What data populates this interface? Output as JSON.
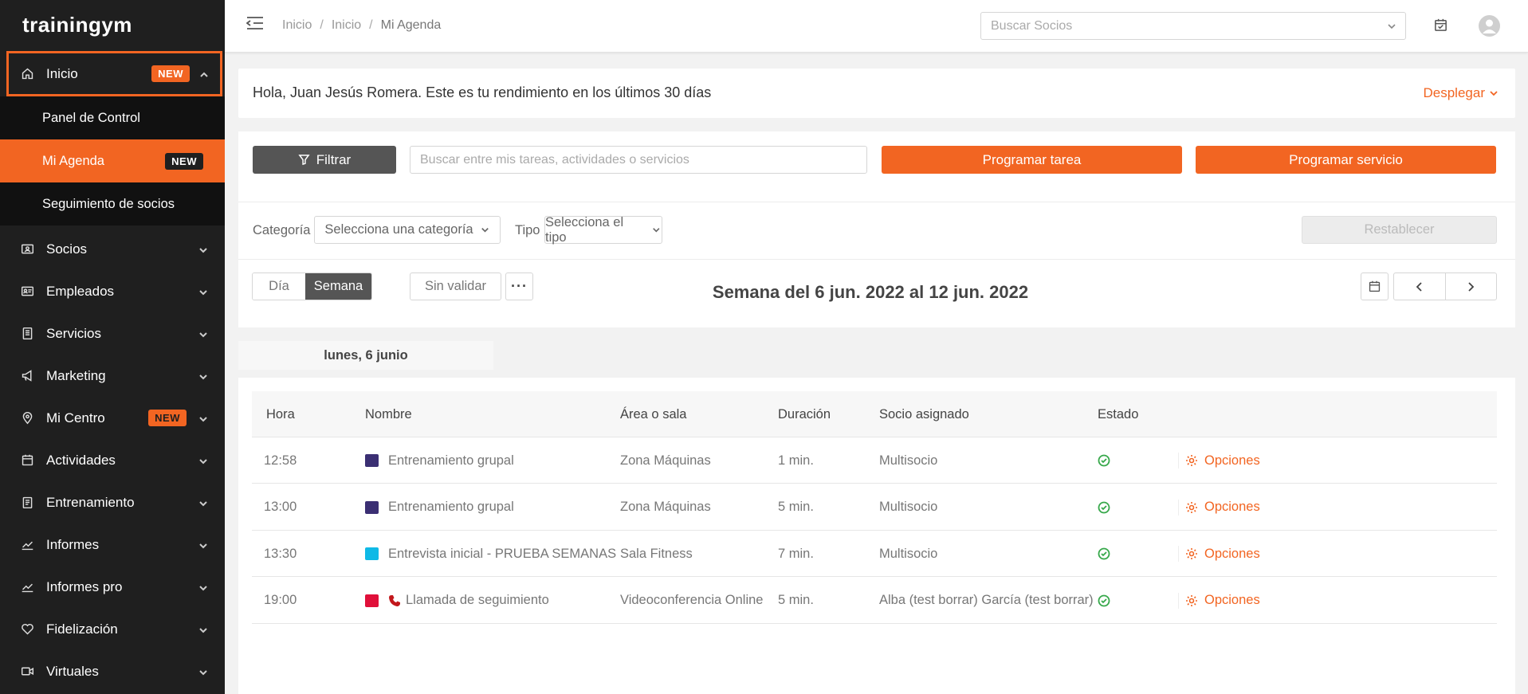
{
  "brand": {
    "logo_text": "trainingym",
    "accent": "#f26522",
    "sidebar_bg": "#1f1f1f"
  },
  "sidebar": {
    "home": {
      "label": "Inicio",
      "badge": "NEW",
      "icon": "home-icon"
    },
    "submenu": [
      {
        "label": "Panel de Control",
        "badge": ""
      },
      {
        "label": "Mi Agenda",
        "badge": "NEW"
      },
      {
        "label": "Seguimiento de socios",
        "badge": ""
      }
    ],
    "items": [
      {
        "label": "Socios",
        "icon": "id-card-icon",
        "badge": ""
      },
      {
        "label": "Empleados",
        "icon": "badge-icon",
        "badge": ""
      },
      {
        "label": "Servicios",
        "icon": "document-icon",
        "badge": ""
      },
      {
        "label": "Marketing",
        "icon": "megaphone-icon",
        "badge": ""
      },
      {
        "label": "Mi Centro",
        "icon": "location-pin-icon",
        "badge": "NEW"
      },
      {
        "label": "Actividades",
        "icon": "calendar-icon",
        "badge": ""
      },
      {
        "label": "Entrenamiento",
        "icon": "clipboard-icon",
        "badge": ""
      },
      {
        "label": "Informes",
        "icon": "chart-line-icon",
        "badge": ""
      },
      {
        "label": "Informes pro",
        "icon": "chart-line-icon",
        "badge": ""
      },
      {
        "label": "Fidelización",
        "icon": "heart-icon",
        "badge": ""
      },
      {
        "label": "Virtuales",
        "icon": "video-icon",
        "badge": ""
      }
    ]
  },
  "header": {
    "breadcrumb": [
      "Inicio",
      "Inicio",
      "Mi Agenda"
    ],
    "search_placeholder": "Buscar Socios"
  },
  "greeting": {
    "text": "Hola, Juan Jesús Romera. Este es tu rendimiento en los últimos 30 días",
    "expand_label": "Desplegar"
  },
  "agenda": {
    "filter_label": "Filtrar",
    "search_placeholder": "Buscar entre mis tareas, actividades o servicios",
    "schedule_task": "Programar tarea",
    "schedule_service": "Programar servicio",
    "category_label": "Categoría",
    "category_placeholder": "Selecciona una categoría",
    "type_label": "Tipo",
    "type_placeholder": "Selecciona el tipo",
    "reset_label": "Restablecer",
    "view_day": "Día",
    "view_week": "Semana",
    "unvalidated": "Sin validar",
    "more": "···",
    "week_title": "Semana del 6 jun. 2022 al 12 jun. 2022"
  },
  "day_tab": "lunes, 6 junio",
  "table": {
    "columns": [
      "Hora",
      "Nombre",
      "Área o sala",
      "Duración",
      "Socio asignado",
      "Estado"
    ],
    "rows": [
      {
        "time": "12:58",
        "color": "#3b2f73",
        "phone": false,
        "name": "Entrenamiento grupal",
        "room": "Zona Máquinas",
        "duration": "1 min.",
        "member": "Multisocio",
        "status": "check-circle-icon",
        "options": "Opciones"
      },
      {
        "time": "13:00",
        "color": "#3b2f73",
        "phone": false,
        "name": "Entrenamiento grupal",
        "room": "Zona Máquinas",
        "duration": "5 min.",
        "member": "Multisocio",
        "status": "check-circle-icon",
        "options": "Opciones"
      },
      {
        "time": "13:30",
        "color": "#0fb9e6",
        "phone": false,
        "name": "Entrevista inicial - PRUEBA SEMANAS",
        "room": "Sala Fitness",
        "duration": "7 min.",
        "member": "Multisocio",
        "status": "check-circle-icon",
        "options": "Opciones"
      },
      {
        "time": "19:00",
        "color": "#e0103a",
        "phone": true,
        "name": "Llamada de seguimiento",
        "room": "Videoconferencia Online",
        "duration": "5 min.",
        "member": "Alba (test borrar) García (test borrar)",
        "status": "check-circle-icon",
        "options": "Opciones"
      }
    ]
  }
}
